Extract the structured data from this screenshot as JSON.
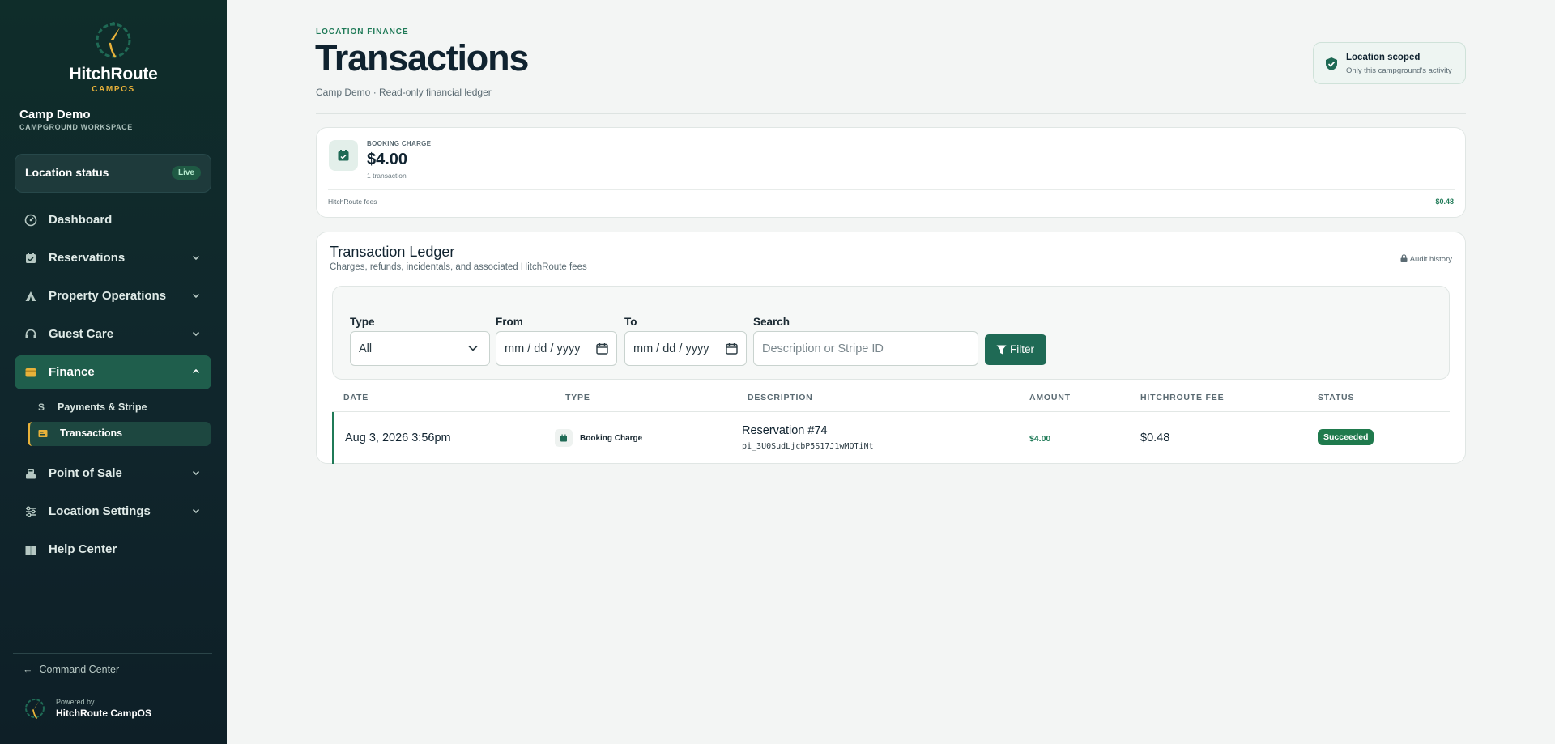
{
  "colors": {
    "accent": "#1f6a55",
    "brand_gold": "#e8b23a",
    "sidebar_bg": "#0f2d2a",
    "success": "#1f7a4d"
  },
  "brand": {
    "name": "HitchRoute",
    "sub": "CAMPOS"
  },
  "workspace": {
    "name": "Camp Demo",
    "sub": "CAMPGROUND WORKSPACE"
  },
  "location_status": {
    "label": "Location status",
    "badge": "Live"
  },
  "nav": {
    "dashboard": {
      "label": "Dashboard",
      "icon": "dashboard-icon"
    },
    "reservations": {
      "label": "Reservations",
      "icon": "calendar-icon"
    },
    "property": {
      "label": "Property Operations",
      "icon": "tent-icon"
    },
    "guest": {
      "label": "Guest Care",
      "icon": "headset-icon"
    },
    "finance": {
      "label": "Finance",
      "icon": "wallet-icon"
    },
    "payments": {
      "label": "Payments & Stripe",
      "icon": "S"
    },
    "transactions": {
      "label": "Transactions",
      "icon": "receipt-icon"
    },
    "pos": {
      "label": "Point of Sale",
      "icon": "register-icon"
    },
    "settings": {
      "label": "Location Settings",
      "icon": "sliders-icon"
    },
    "help": {
      "label": "Help Center",
      "icon": "book-icon"
    }
  },
  "command_center": "Command Center",
  "powered": {
    "small": "Powered by",
    "big": "HitchRoute CampOS"
  },
  "header": {
    "eyebrow": "LOCATION FINANCE",
    "title": "Transactions",
    "subtitle": "Camp Demo · Read-only financial ledger"
  },
  "scope": {
    "title": "Location scoped",
    "sub": "Only this campground's activity"
  },
  "summary": {
    "label": "BOOKING CHARGE",
    "amount": "$4.00",
    "count": "1 transaction",
    "fees_label": "HitchRoute fees",
    "fees_value": "$0.48"
  },
  "ledger": {
    "title": "Transaction Ledger",
    "subtitle": "Charges, refunds, incidentals, and associated HitchRoute fees",
    "audit": "Audit history"
  },
  "filters": {
    "type_label": "Type",
    "type_value": "All",
    "from_label": "From",
    "from_placeholder": "mm / dd / yyyy",
    "to_label": "To",
    "to_placeholder": "mm / dd / yyyy",
    "search_label": "Search",
    "search_placeholder": "Description or Stripe ID",
    "button": "Filter"
  },
  "table": {
    "headers": [
      "DATE",
      "TYPE",
      "DESCRIPTION",
      "AMOUNT",
      "HITCHROUTE FEE",
      "STATUS"
    ],
    "rows": [
      {
        "date": "Aug 3, 2026 3:56pm",
        "type": "Booking Charge",
        "description": "Reservation #74",
        "stripe_id": "pi_3U0SudLjcbP5S17J1wMQTiNt",
        "amount": "$4.00",
        "fee": "$0.48",
        "status": "Succeeded"
      }
    ]
  }
}
